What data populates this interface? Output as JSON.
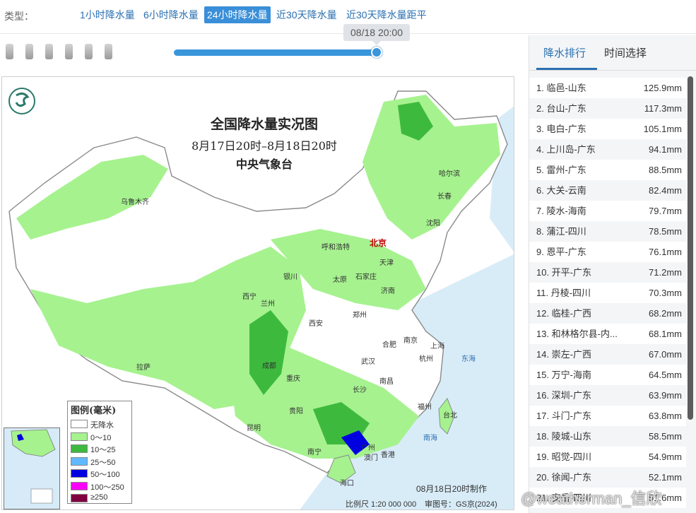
{
  "type_bar": {
    "label": "类型：",
    "options": [
      {
        "label": "1小时降水量",
        "active": false
      },
      {
        "label": "6小时降水量",
        "active": false
      },
      {
        "label": "24小时降水量",
        "active": true
      },
      {
        "label": "近30天降水量",
        "active": false
      },
      {
        "label": "近30天降水量距平",
        "active": false
      }
    ]
  },
  "timeline": {
    "tooltip": "08/18 20:00",
    "progress": 1.0
  },
  "map": {
    "title": "全国降水量实况图",
    "subtitle": "8月17日20时–8月18日20时",
    "agency": "中央气象台",
    "cities": [
      {
        "name": "乌鲁木齐"
      },
      {
        "name": "哈尔滨"
      },
      {
        "name": "长春"
      },
      {
        "name": "沈阳"
      },
      {
        "name": "呼和浩特"
      },
      {
        "name": "北京"
      },
      {
        "name": "天津"
      },
      {
        "name": "银川"
      },
      {
        "name": "太原"
      },
      {
        "name": "石家庄"
      },
      {
        "name": "济南"
      },
      {
        "name": "西宁"
      },
      {
        "name": "兰州"
      },
      {
        "name": "郑州"
      },
      {
        "name": "西安"
      },
      {
        "name": "合肥"
      },
      {
        "name": "南京"
      },
      {
        "name": "上海"
      },
      {
        "name": "拉萨"
      },
      {
        "name": "成都"
      },
      {
        "name": "武汉"
      },
      {
        "name": "杭州"
      },
      {
        "name": "重庆"
      },
      {
        "name": "长沙"
      },
      {
        "name": "南昌"
      },
      {
        "name": "贵阳"
      },
      {
        "name": "福州"
      },
      {
        "name": "台北"
      },
      {
        "name": "昆明"
      },
      {
        "name": "南宁"
      },
      {
        "name": "广州"
      },
      {
        "name": "香港"
      },
      {
        "name": "澳门"
      },
      {
        "name": "海口"
      }
    ],
    "legend": {
      "title": "图例(毫米)",
      "items": [
        {
          "label": "无降水",
          "color": "#ffffff"
        },
        {
          "label": "0～10",
          "color": "#a6f28f"
        },
        {
          "label": "10～25",
          "color": "#3dba3d"
        },
        {
          "label": "25～50",
          "color": "#61b8ff"
        },
        {
          "label": "50～100",
          "color": "#0000e1"
        },
        {
          "label": "100～250",
          "color": "#fa00fa"
        },
        {
          "label": "≥250",
          "color": "#800040"
        }
      ]
    },
    "footer_time": "08月18日20时制作",
    "footer_scale": "比例尺 1:20 000 000",
    "footer_approval": "审图号：GS京(2024)",
    "sea_label_east": "东海",
    "sea_label_south": "南海"
  },
  "ranking": {
    "tabs": [
      {
        "label": "降水排行",
        "active": true
      },
      {
        "label": "时间选择",
        "active": false
      }
    ],
    "items": [
      {
        "name": "1. 临邑-山东",
        "value": "125.9mm"
      },
      {
        "name": "2. 台山-广东",
        "value": "117.3mm"
      },
      {
        "name": "3. 电白-广东",
        "value": "105.1mm"
      },
      {
        "name": "4. 上川岛-广东",
        "value": "94.1mm"
      },
      {
        "name": "5. 雷州-广东",
        "value": "88.5mm"
      },
      {
        "name": "6. 大关-云南",
        "value": "82.4mm"
      },
      {
        "name": "7. 陵水-海南",
        "value": "79.7mm"
      },
      {
        "name": "8. 蒲江-四川",
        "value": "78.5mm"
      },
      {
        "name": "9. 恩平-广东",
        "value": "76.1mm"
      },
      {
        "name": "10. 开平-广东",
        "value": "71.2mm"
      },
      {
        "name": "11. 丹棱-四川",
        "value": "70.3mm"
      },
      {
        "name": "12. 临桂-广西",
        "value": "68.2mm"
      },
      {
        "name": "13. 和林格尔县-内...",
        "value": "68.1mm"
      },
      {
        "name": "14. 崇左-广西",
        "value": "67.0mm"
      },
      {
        "name": "15. 万宁-海南",
        "value": "64.5mm"
      },
      {
        "name": "16. 深圳-广东",
        "value": "63.9mm"
      },
      {
        "name": "17. 斗门-广东",
        "value": "63.8mm"
      },
      {
        "name": "18. 陵城-山东",
        "value": "58.5mm"
      },
      {
        "name": "19. 昭觉-四川",
        "value": "54.9mm"
      },
      {
        "name": "20. 徐闻-广东",
        "value": "52.1mm"
      },
      {
        "name": "21. 安岳-四川",
        "value": "51.6mm"
      }
    ]
  },
  "watermark": "@weatherman_信欣"
}
